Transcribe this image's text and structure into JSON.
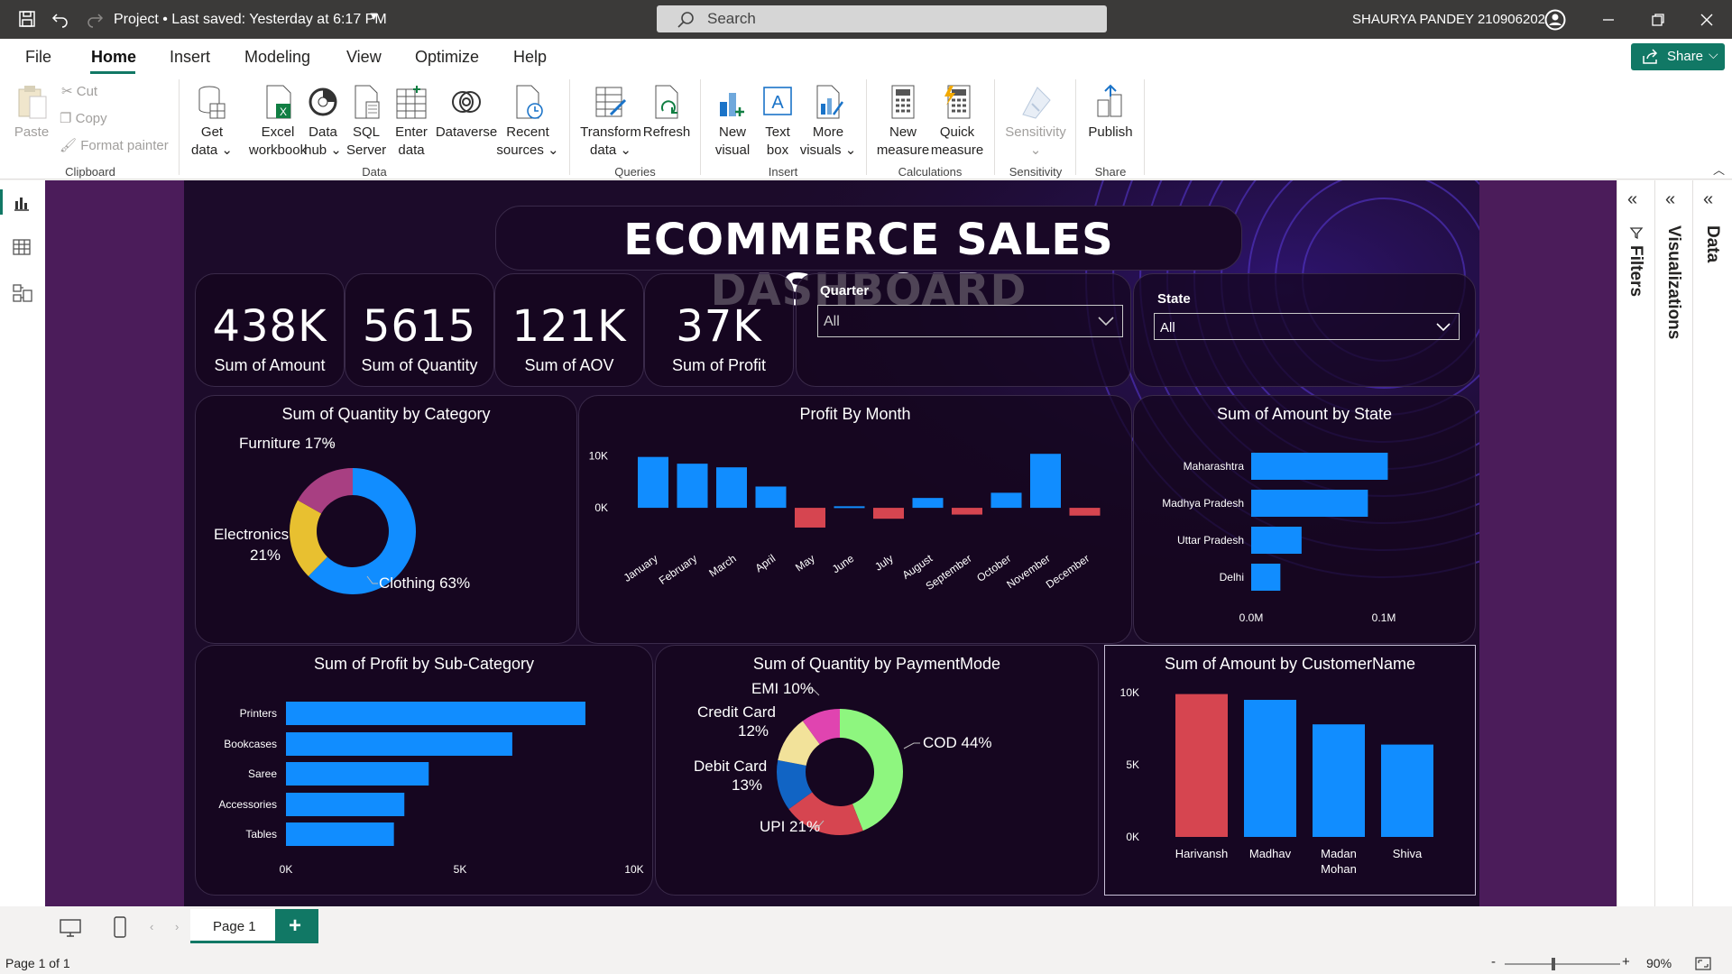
{
  "titlebar": {
    "project_title": "Project • Last saved: Yesterday at 6:17 PM",
    "search_label": "Search",
    "user": "SHAURYA PANDEY 210906202"
  },
  "menu": {
    "items": [
      "File",
      "Home",
      "Insert",
      "Modeling",
      "View",
      "Optimize",
      "Help"
    ],
    "share": "Share"
  },
  "ribbon": {
    "clipboard": {
      "paste": "Paste",
      "cut": "Cut",
      "copy": "Copy",
      "format_painter": "Format painter",
      "group": "Clipboard"
    },
    "data": {
      "get_data": [
        "Get",
        "data"
      ],
      "excel": [
        "Excel",
        "workbook"
      ],
      "data_hub": [
        "Data",
        "hub"
      ],
      "sql": [
        "SQL",
        "Server"
      ],
      "enter": [
        "Enter",
        "data"
      ],
      "dataverse": "Dataverse",
      "recent": [
        "Recent",
        "sources"
      ],
      "group": "Data"
    },
    "queries": {
      "transform": [
        "Transform",
        "data"
      ],
      "refresh": "Refresh",
      "group": "Queries"
    },
    "insert": {
      "new_visual": [
        "New",
        "visual"
      ],
      "text_box": [
        "Text",
        "box"
      ],
      "more_visuals": [
        "More",
        "visuals"
      ],
      "group": "Insert"
    },
    "calculations": {
      "new_measure": [
        "New",
        "measure"
      ],
      "quick_measure": [
        "Quick",
        "measure"
      ],
      "group": "Calculations"
    },
    "sensitivity": {
      "label": "Sensitivity",
      "group": "Sensitivity"
    },
    "share": {
      "publish": "Publish",
      "group": "Share"
    }
  },
  "dashboard": {
    "title": "ECOMMERCE SALES DASHBOARD",
    "kpis": [
      {
        "value": "438K",
        "label": "Sum of Amount"
      },
      {
        "value": "5615",
        "label": "Sum of Quantity"
      },
      {
        "value": "121K",
        "label": "Sum of AOV"
      },
      {
        "value": "37K",
        "label": "Sum of Profit"
      }
    ],
    "filters": {
      "quarter": {
        "label": "Quarter",
        "value": "All"
      },
      "state": {
        "label": "State",
        "value": "All"
      }
    }
  },
  "colors": {
    "blue": "#118dff",
    "red": "#d64550",
    "yellow": "#e8c030",
    "magenta": "#a83f82",
    "green": "#8ef67f",
    "pink": "#e044b0",
    "cream": "#f2e29a",
    "darkblue": "#1164c4",
    "canvas": "#1c0b2a"
  },
  "chart_data": [
    {
      "type": "pie",
      "title": "Sum of Quantity by Category",
      "labels": [
        "Clothing",
        "Electronics",
        "Furniture"
      ],
      "values": [
        63,
        21,
        17
      ],
      "slice_labels": [
        "Clothing 63%",
        "Electronics",
        "21%",
        "Furniture 17%"
      ],
      "colors": [
        "#118dff",
        "#e8c030",
        "#a83f82"
      ]
    },
    {
      "type": "bar",
      "title": "Profit By Month",
      "categories": [
        "January",
        "February",
        "March",
        "April",
        "May",
        "June",
        "July",
        "August",
        "September",
        "October",
        "November",
        "December"
      ],
      "values": [
        9800,
        8500,
        7800,
        4100,
        -3800,
        300,
        -2100,
        1900,
        -1300,
        2900,
        10400,
        -1500
      ],
      "yticks": [
        "10K",
        "0K"
      ],
      "ylim": [
        -4500,
        12000
      ]
    },
    {
      "type": "bar",
      "orientation": "horizontal",
      "title": "Sum of Amount by State",
      "categories": [
        "Maharashtra",
        "Madhya Pradesh",
        "Uttar Pradesh",
        "Delhi"
      ],
      "values": [
        0.103,
        0.088,
        0.038,
        0.022
      ],
      "xticks": [
        "0.0M",
        "0.1M"
      ],
      "xlim": [
        0,
        0.1
      ]
    },
    {
      "type": "bar",
      "orientation": "horizontal",
      "title": "Sum of Profit by Sub-Category",
      "categories": [
        "Printers",
        "Bookcases",
        "Saree",
        "Accessories",
        "Tables"
      ],
      "values": [
        8600,
        6500,
        4100,
        3400,
        3100
      ],
      "xticks": [
        "0K",
        "5K",
        "10K"
      ],
      "xlim": [
        0,
        10000
      ]
    },
    {
      "type": "pie",
      "title": "Sum of Quantity by PaymentMode",
      "labels": [
        "COD",
        "UPI",
        "Debit Card",
        "Credit Card",
        "EMI"
      ],
      "values": [
        44,
        21,
        13,
        12,
        10
      ],
      "slice_labels": [
        "COD 44%",
        "UPI 21%",
        "Debit Card",
        "13%",
        "Credit Card",
        "12%",
        "EMI 10%"
      ],
      "colors": [
        "#8ef67f",
        "#d64550",
        "#1164c4",
        "#f2e29a",
        "#e044b0"
      ]
    },
    {
      "type": "bar",
      "title": "Sum of Amount by CustomerName",
      "categories": [
        "Harivansh",
        "Madhav",
        "Madan Mohan",
        "Shiva"
      ],
      "category_lines": [
        [
          "Harivansh"
        ],
        [
          "Madhav"
        ],
        [
          "Madan",
          "Mohan"
        ],
        [
          "Shiva"
        ]
      ],
      "values": [
        9900,
        9500,
        7800,
        6400
      ],
      "yticks": [
        "10K",
        "5K",
        "0K"
      ],
      "ylim": [
        0,
        10000
      ],
      "colors": [
        "#d64550",
        "#118dff",
        "#118dff",
        "#118dff"
      ]
    }
  ],
  "panes": {
    "filters": "Filters",
    "visualizations": "Visualizations",
    "data": "Data"
  },
  "pages": {
    "tab": "Page 1",
    "status": "Page 1 of 1",
    "zoom": "90%"
  }
}
